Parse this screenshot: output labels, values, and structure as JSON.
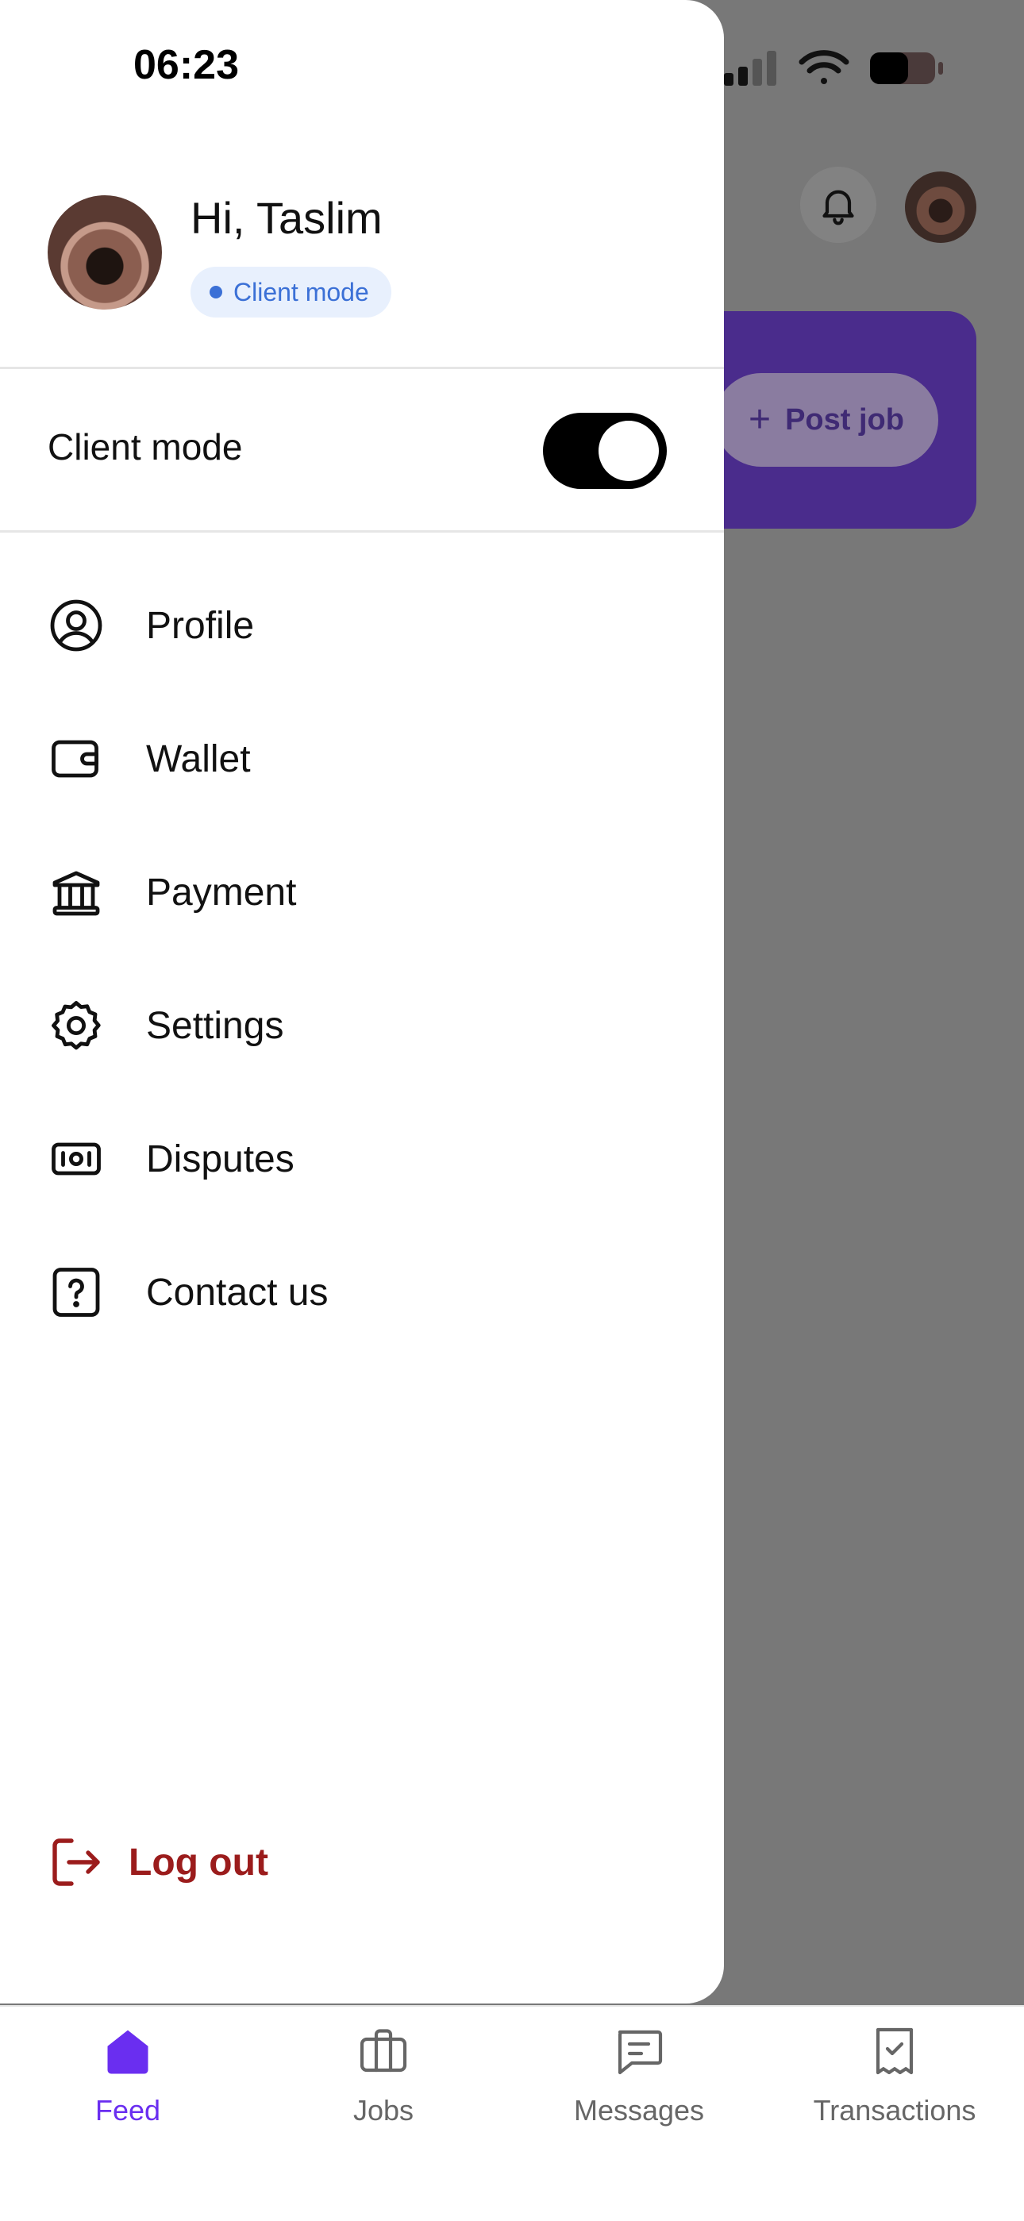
{
  "status_bar": {
    "time": "06:23"
  },
  "background_screen": {
    "post_job_label": "Post job"
  },
  "drawer": {
    "greeting": "Hi, Taslim",
    "mode_badge": "Client mode",
    "mode_toggle": {
      "label": "Client mode",
      "enabled": true
    },
    "menu": [
      {
        "label": "Profile",
        "icon": "user-circle-icon"
      },
      {
        "label": "Wallet",
        "icon": "wallet-icon"
      },
      {
        "label": "Payment",
        "icon": "bank-icon"
      },
      {
        "label": "Settings",
        "icon": "gear-icon"
      },
      {
        "label": "Disputes",
        "icon": "banknote-icon"
      },
      {
        "label": "Contact us",
        "icon": "question-square-icon"
      }
    ],
    "logout_label": "Log out"
  },
  "bottom_nav": {
    "items": [
      {
        "label": "Feed",
        "icon": "home-icon",
        "active": true
      },
      {
        "label": "Jobs",
        "icon": "briefcase-icon",
        "active": false
      },
      {
        "label": "Messages",
        "icon": "message-icon",
        "active": false
      },
      {
        "label": "Transactions",
        "icon": "receipt-check-icon",
        "active": false
      }
    ]
  },
  "colors": {
    "accent": "#6a2ef0",
    "badge_text": "#3b70d6",
    "logout": "#9b1c1c",
    "overlay": "#787878"
  }
}
